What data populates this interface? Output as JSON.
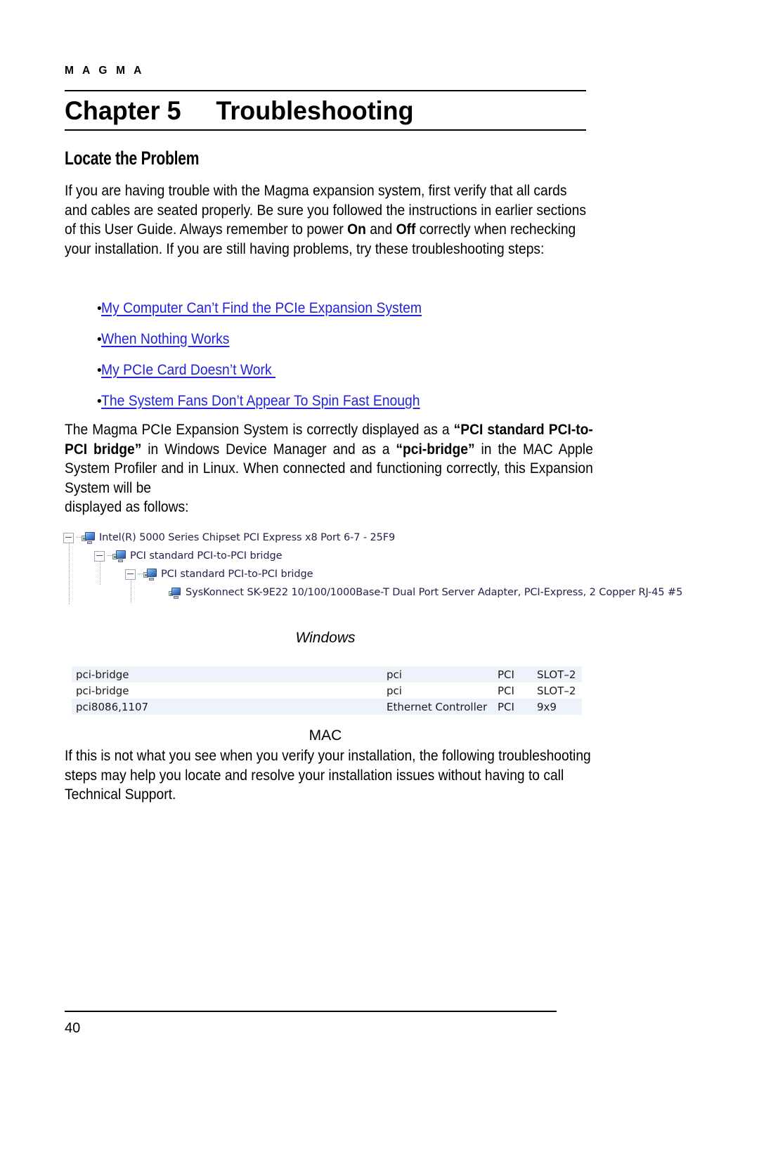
{
  "header": {
    "running_head": "M A G M A"
  },
  "chapter": {
    "title": "Chapter 5     Troubleshooting"
  },
  "section": {
    "heading": "Locate the Problem"
  },
  "paragraphs": {
    "intro_part1": "If you are having trouble with the Magma expansion system, first verify that all cards and cables are seated properly. Be sure you followed the instructions in earlier sections of this User Guide. Always remember to power ",
    "intro_bold_on": "On",
    "intro_part2": " and ",
    "intro_bold_off": "Off",
    "intro_part3": " correctly when rechecking your installation. If you are still having problems, try these troubleshooting steps:",
    "bridge_part1": "The Magma PCIe Expansion System is correctly displayed as a ",
    "bridge_bold1": "“PCI standard PCI-to-PCI bridge”",
    "bridge_part2": " in Windows Device Manager and as a ",
    "bridge_bold2": "“pci-bridge”",
    "bridge_part3": " in the MAC Apple System Profiler and in Linux. When connected and functioning correctly, this Expansion System will be",
    "bridge_lastline": "displayed as follows:",
    "closing": "If this is not what you see when you verify your installation, the following troubleshooting steps may help you locate and resolve your installation issues without having to call Technical Support."
  },
  "links": {
    "bullet_glyph": "•",
    "items": [
      {
        "label": "My Computer Can’t Find the PCIe Expansion System"
      },
      {
        "label": "When Nothing Works"
      },
      {
        "label": "My PCIe Card Doesn’t Work "
      },
      {
        "label": "The System Fans Don’t Appear To Spin Fast Enough"
      }
    ],
    "color": "#2222dd"
  },
  "device_tree": {
    "rows": [
      {
        "level": 0,
        "expander": "minus",
        "icon": "pci-bridge-device-icon",
        "label": "Intel(R) 5000 Series Chipset PCI Express x8 Port 6-7 - 25F9"
      },
      {
        "level": 1,
        "expander": "minus",
        "icon": "pci-bridge-device-icon",
        "label": "PCI standard PCI-to-PCI bridge"
      },
      {
        "level": 2,
        "expander": "minus",
        "icon": "pci-bridge-device-icon",
        "label": "PCI standard PCI-to-PCI bridge"
      },
      {
        "level": 3,
        "expander": "none",
        "icon": "network-adapter-icon",
        "label": "SysKonnect SK-9E22 10/100/1000Base-T Dual Port Server Adapter, PCI-Express, 2 Copper RJ-45 #5"
      }
    ]
  },
  "captions": {
    "windows": "Windows",
    "mac": "MAC"
  },
  "mac_table": {
    "rows": [
      {
        "name": "pci-bridge",
        "type": "pci",
        "bus": "PCI",
        "slot": "SLOT–2",
        "shade": "alt"
      },
      {
        "name": "pci-bridge",
        "type": "pci",
        "bus": "PCI",
        "slot": "SLOT–2",
        "shade": "plain"
      },
      {
        "name": "pci8086,1107",
        "type": "Ethernet Controller",
        "bus": "PCI",
        "slot": "9x9",
        "shade": "alt"
      }
    ],
    "row_alt_color": "#eef2fb"
  },
  "footer": {
    "page_number": "40"
  }
}
